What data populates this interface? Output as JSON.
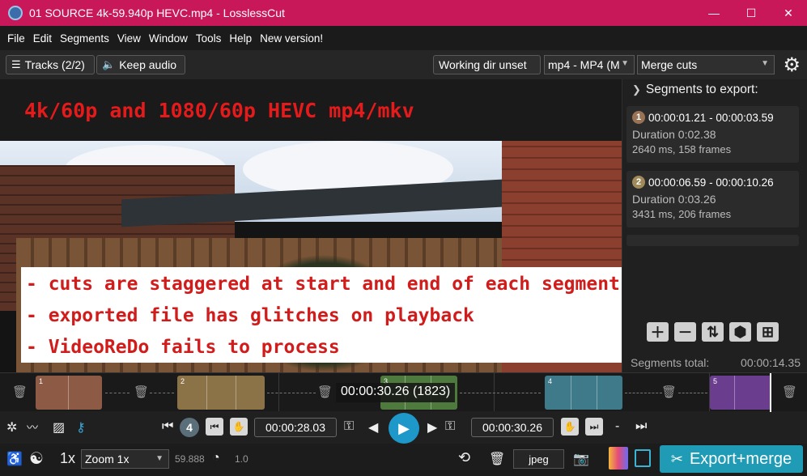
{
  "window": {
    "title": "01 SOURCE 4k-59.940p HEVC.mp4 - LosslessCut",
    "minimize": "—",
    "maximize": "☐",
    "close": "✕"
  },
  "menu": [
    "File",
    "Edit",
    "Segments",
    "View",
    "Window",
    "Tools",
    "Help",
    "New version!"
  ],
  "toolbar": {
    "tracks": "Tracks (2/2)",
    "keep_audio": "Keep audio",
    "working_dir": "Working dir unset",
    "format": "mp4 - MP4 (M",
    "merge_mode": "Merge cuts"
  },
  "video": {
    "headline": "4k/60p and 1080/60p HEVC mp4/mkv",
    "notes": [
      "- cuts are staggered at start and end of each segment",
      "- exported file has glitches on playback",
      "- VideoReDo fails to process"
    ]
  },
  "sidebar": {
    "title": "Segments to export:",
    "segments": [
      {
        "num": "1",
        "range": "00:00:01.21 - 00:00:03.59",
        "duration": "Duration 0:02.38",
        "info": "2640 ms, 158 frames",
        "color": "#9a7356"
      },
      {
        "num": "2",
        "range": "00:00:06.59 - 00:00:10.26",
        "duration": "Duration 0:03.26",
        "info": "3431 ms, 206 frames",
        "color": "#a08a5a"
      }
    ],
    "total_label": "Segments total:",
    "total_value": "00:00:14.35"
  },
  "timeline": {
    "current_time": "00:00:30.26 (1823)",
    "segments": [
      {
        "label": "1",
        "color": "#8c5a45"
      },
      {
        "label": "2",
        "color": "#8c7347"
      },
      {
        "label": "3",
        "color": "#4f7a3d"
      },
      {
        "label": "4",
        "color": "#3f7a8a"
      },
      {
        "label": "5",
        "color": "#6b3d8f"
      }
    ]
  },
  "controls": {
    "segment_number": "4",
    "start_time": "00:00:28.03",
    "end_time": "00:00:30.26",
    "dash": "-"
  },
  "bottom": {
    "speed": "1x",
    "zoom": "Zoom 1x",
    "fps": "59.888",
    "rate": "1.0",
    "capture_format": "jpeg",
    "export": "Export+merge"
  }
}
